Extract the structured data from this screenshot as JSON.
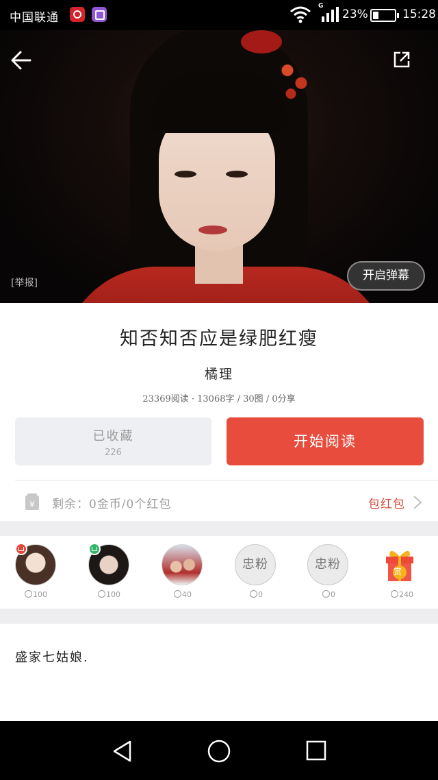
{
  "status_bar": {
    "carrier": "中国联通",
    "network_badge": "G",
    "battery": "23%",
    "time": "15:28"
  },
  "hero": {
    "report_label": "[举报]",
    "danmaku_button": "开启弹幕"
  },
  "book": {
    "title": "知否知否应是绿肥红瘦",
    "author": "橘理",
    "stats": "23369阅读 · 13068字 / 30图 / 0分享",
    "favorite_label": "已收藏",
    "favorite_count": "226",
    "read_button": "开始阅读"
  },
  "balance": {
    "text": "剩余：0金币/0个红包",
    "redpack_link": "包红包"
  },
  "fans": [
    {
      "name": "",
      "coins": "100",
      "badge": "red"
    },
    {
      "name": "",
      "coins": "100",
      "badge": "green"
    },
    {
      "name": "",
      "coins": "40"
    },
    {
      "name": "忠粉",
      "coins": "0"
    },
    {
      "name": "忠粉",
      "coins": "0"
    },
    {
      "name": "赏",
      "coins": "240"
    }
  ],
  "description": "盛家七姑娘.",
  "icons": {
    "back": "back-arrow-icon",
    "share": "share-icon",
    "wallet": "wallet-icon",
    "chevron": "chevron-right-icon",
    "gift": "gift-box-icon",
    "coin": "coin-icon"
  },
  "colors": {
    "accent": "#e84c3d",
    "link_red": "#d3473b",
    "band_grey": "#eeeef0"
  }
}
